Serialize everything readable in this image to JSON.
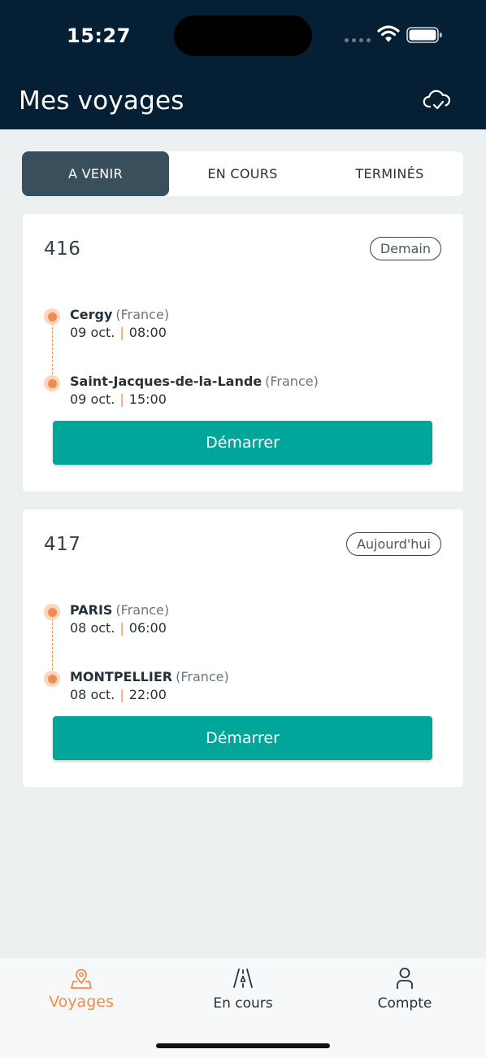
{
  "status_bar": {
    "time": "15:27"
  },
  "header": {
    "title": "Mes voyages",
    "sync_icon": "cloud-check-icon"
  },
  "tabs": [
    {
      "label": "A VENIR",
      "active": true
    },
    {
      "label": "EN COURS",
      "active": false
    },
    {
      "label": "TERMINÉS",
      "active": false
    }
  ],
  "trips": [
    {
      "number": "416",
      "badge": "Demain",
      "origin": {
        "city": "Cergy",
        "country": "(France)",
        "date": "09 oct.",
        "time": "08:00"
      },
      "destination": {
        "city": "Saint-Jacques-de-la-Lande",
        "country": "(France)",
        "date": "09 oct.",
        "time": "15:00"
      },
      "action_label": "Démarrer"
    },
    {
      "number": "417",
      "badge": "Aujourd'hui",
      "origin": {
        "city": "PARIS",
        "country": "(France)",
        "date": "08 oct.",
        "time": "06:00"
      },
      "destination": {
        "city": "MONTPELLIER",
        "country": "(France)",
        "date": "08 oct.",
        "time": "22:00"
      },
      "action_label": "Démarrer"
    }
  ],
  "separator": "|",
  "bottom_nav": [
    {
      "label": "Voyages",
      "icon": "map-pin-icon",
      "active": true
    },
    {
      "label": "En cours",
      "icon": "road-icon",
      "active": false
    },
    {
      "label": "Compte",
      "icon": "user-icon",
      "active": false
    }
  ],
  "colors": {
    "header_bg": "#052035",
    "accent_orange": "#ef8d4d",
    "button_teal": "#00a69a",
    "active_tab": "#3a4f5c"
  }
}
